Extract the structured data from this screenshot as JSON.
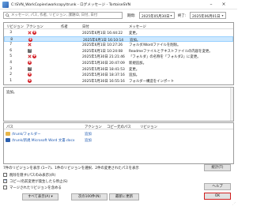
{
  "window": {
    "title": "C:\\SVN_WorkCopies\\workcopy\\trunk - ログメッセージ - TortoiseSVN"
  },
  "filter": {
    "search_placeholder": "メッセージ, パス, 作者, リビジョン, 課題ID, 日付, 日付",
    "from_label": "期間:",
    "from_date": "2025年05月30日",
    "to_label": "終了:",
    "to_date": "2025年06月01日"
  },
  "log": {
    "columns": [
      "リビジョン",
      "アクション",
      "作者",
      "日付",
      "メッセージ"
    ],
    "rows": [
      {
        "rev": "3",
        "actions": [
          "del",
          "add"
        ],
        "author": "",
        "date": "2025年6月1日 16:44:22",
        "message": "変更。",
        "selected": false
      },
      {
        "rev": "8",
        "actions": [
          "add"
        ],
        "author": "",
        "date": "2025年6月1日 16:10:14",
        "message": "追加。",
        "selected": true
      },
      {
        "rev": "7",
        "actions": [
          "del"
        ],
        "author": "",
        "date": "2025年6月1日 10:27:26",
        "message": "フォルダ/Wordファイルを削除。",
        "selected": false
      },
      {
        "rev": "6",
        "actions": [
          "mod"
        ],
        "author": "",
        "date": "2025年6月1日 10:24:08",
        "message": "Readmeファイルとテキストファイルの内容を変更。",
        "selected": false
      },
      {
        "rev": "5",
        "actions": [
          "del",
          "add"
        ],
        "author": "",
        "date": "2025年5月30日 21:21:46",
        "message": "「フォルダ」の名称を「フォルダ2」に変更。",
        "selected": false
      },
      {
        "rev": "4",
        "actions": [
          "add"
        ],
        "author": "",
        "date": "2025年5月30日 20:47:09",
        "message": "新規追加。",
        "selected": false
      },
      {
        "rev": "3",
        "actions": [
          "mod"
        ],
        "author": "",
        "date": "2025年5月30日 18:41:53",
        "message": "変更。",
        "selected": false
      },
      {
        "rev": "2",
        "actions": [
          "add"
        ],
        "author": "",
        "date": "2025年5月30日 18:37:16",
        "message": "追加。",
        "selected": false
      },
      {
        "rev": "1",
        "actions": [
          "add"
        ],
        "author": "",
        "date": "2025年5月30日 16:55:16",
        "message": "フォルダー構造をインポート",
        "selected": false
      }
    ]
  },
  "message_pane": {
    "text": "追加。"
  },
  "paths": {
    "columns": [
      "パス",
      "アクション",
      "コピー元のパス",
      "リビジョン"
    ],
    "rows": [
      {
        "icon": "folder",
        "path": "/trunk/フォルダー",
        "action": "追加"
      },
      {
        "icon": "doc",
        "path": "/trunk/新規 Microsoft Word 文書.docx",
        "action": "追加"
      }
    ]
  },
  "status_text": "7件のリビジョンを表示 (1~7)、1件のリビジョンを選択、2件の変更されたパスを表示",
  "options": [
    {
      "label": "削除を隠す(パスのみ表示)(R)",
      "checked": false
    },
    {
      "label": "コピー/名前変更が発生したら停止(S)",
      "checked": true
    },
    {
      "label": "マージされたリビジョンを含める",
      "checked": false
    }
  ],
  "buttons": {
    "show_all": "すべて表示(A)",
    "next100": "次の100件(N)",
    "refresh": "最新に更新",
    "stats": "統計(T)",
    "help": "ヘルプ",
    "ok": "OK"
  }
}
